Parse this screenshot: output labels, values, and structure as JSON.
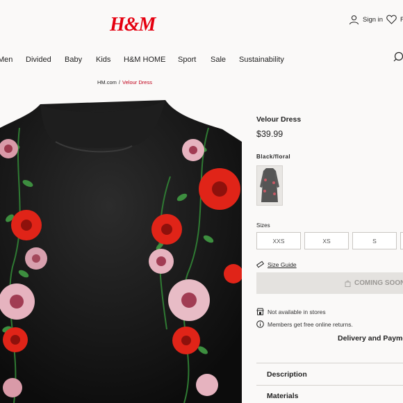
{
  "header": {
    "logo": "H&M",
    "sign_in": "Sign in",
    "favourites_partial": "F"
  },
  "nav": {
    "items": [
      "Men",
      "Divided",
      "Baby",
      "Kids",
      "H&M HOME",
      "Sport",
      "Sale",
      "Sustainability"
    ]
  },
  "breadcrumb": {
    "home": "HM.com",
    "separator": "/",
    "current": "Velour Dress"
  },
  "product": {
    "title": "Velour Dress",
    "price": "$39.99",
    "color": "Black/floral",
    "sizes_label": "Sizes",
    "sizes": [
      "XXS",
      "XS",
      "S"
    ],
    "size_guide": "Size Guide",
    "coming_soon": "COMING SOON",
    "not_in_stores": "Not available in stores",
    "free_returns": "Members get free online returns.",
    "delivery": "Delivery and Payment",
    "accordion": [
      "Description",
      "Materials"
    ]
  },
  "colors": {
    "brand_red": "#e50010",
    "breadcrumb_current": "#c0001a",
    "page_bg": "#faf9f8",
    "disabled_button_bg": "#e4e2df"
  },
  "icons": [
    "user-icon",
    "heart-icon",
    "search-icon",
    "ruler-icon",
    "bag-icon",
    "store-icon",
    "info-icon"
  ]
}
